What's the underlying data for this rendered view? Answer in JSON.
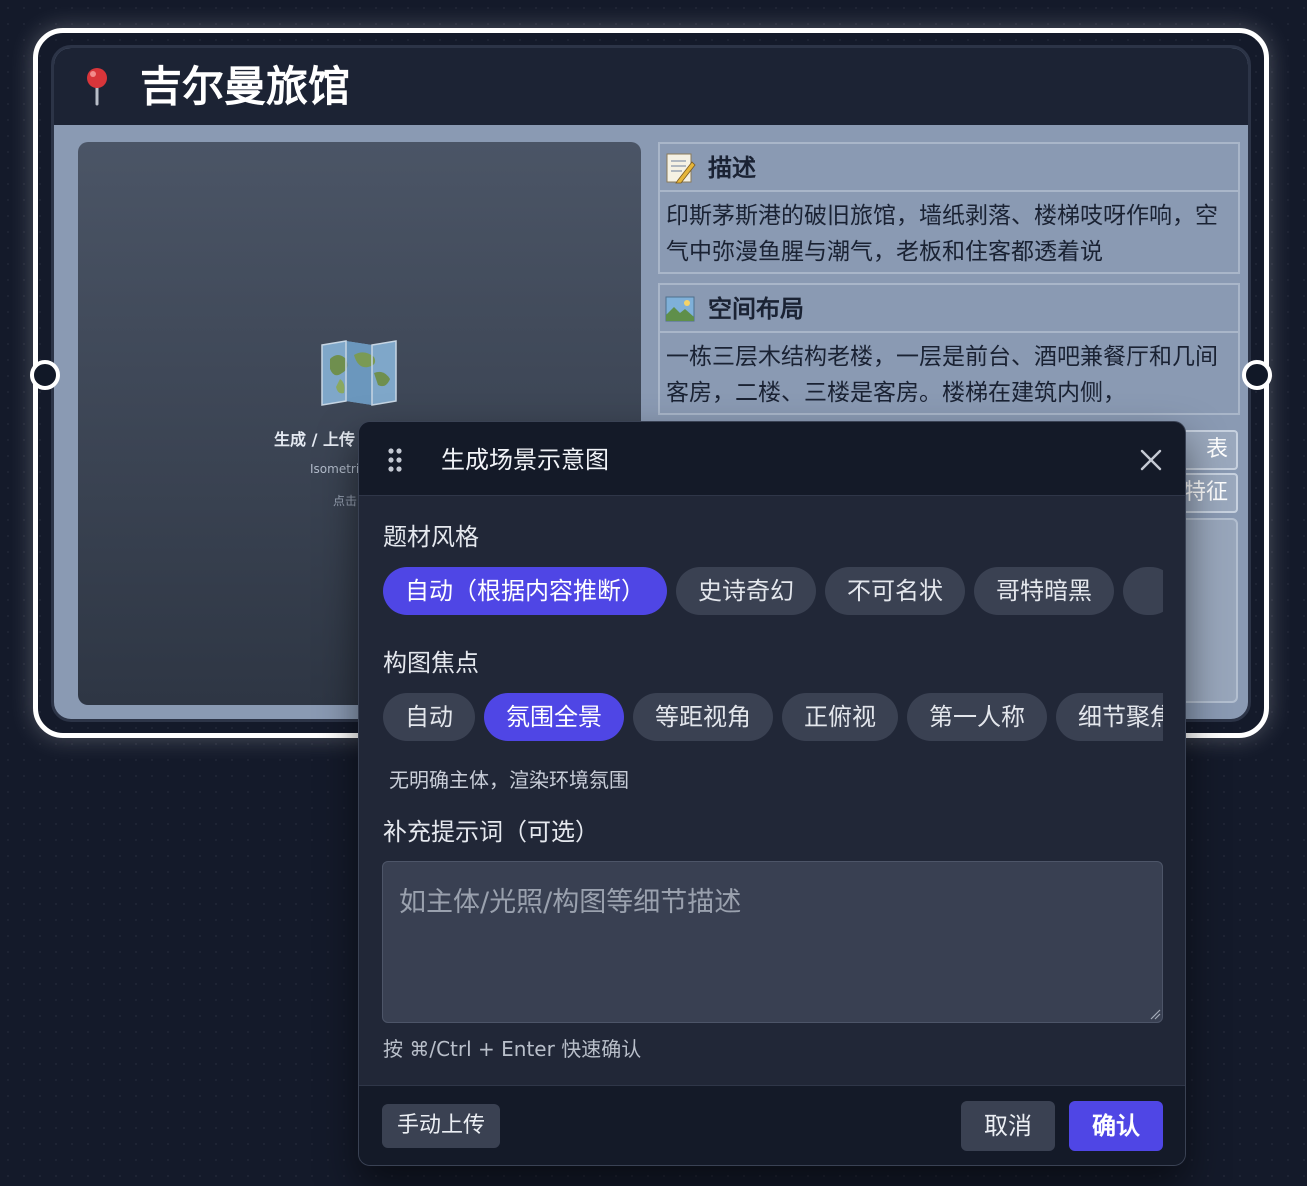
{
  "node": {
    "title": "吉尔曼旅馆",
    "image_panel": {
      "label": "生成 / 上传",
      "sublabel": "Isometri",
      "hint": "点击"
    },
    "sections": [
      {
        "title": "描述",
        "text": "印斯茅斯港的破旧旅馆，墙纸剥落、楼梯吱呀作响，空气中弥漫鱼腥与潮气，老板和住客都透着说"
      },
      {
        "title": "空间布局",
        "text": "一栋三层木结构老楼，一层是前台、酒吧兼餐厅和几间客房，二楼、三楼是客房。楼梯在建筑内侧，"
      }
    ],
    "side_buttons": [
      "表",
      "特征"
    ]
  },
  "modal": {
    "title": "生成场景示意图",
    "style_label": "题材风格",
    "styles": [
      {
        "label": "自动（根据内容推断）",
        "active": true
      },
      {
        "label": "史诗奇幻",
        "active": false
      },
      {
        "label": "不可名状",
        "active": false
      },
      {
        "label": "哥特暗黑",
        "active": false
      }
    ],
    "focus_label": "构图焦点",
    "focuses": [
      {
        "label": "自动",
        "active": false
      },
      {
        "label": "氛围全景",
        "active": true
      },
      {
        "label": "等距视角",
        "active": false
      },
      {
        "label": "正俯视",
        "active": false
      },
      {
        "label": "第一人称",
        "active": false
      },
      {
        "label": "细节聚焦",
        "active": false
      }
    ],
    "focus_hint": "无明确主体，渲染环境氛围",
    "prompt_label": "补充提示词（可选）",
    "prompt_placeholder": "如主体/光照/构图等细节描述",
    "prompt_value": "",
    "shortcut_hint": "按 ⌘/Ctrl + Enter 快速确认",
    "upload_label": "手动上传",
    "cancel_label": "取消",
    "confirm_label": "确认"
  },
  "colors": {
    "accent": "#4f46e5",
    "modal_bg": "#212737",
    "node_body": "#8a9ab3"
  }
}
